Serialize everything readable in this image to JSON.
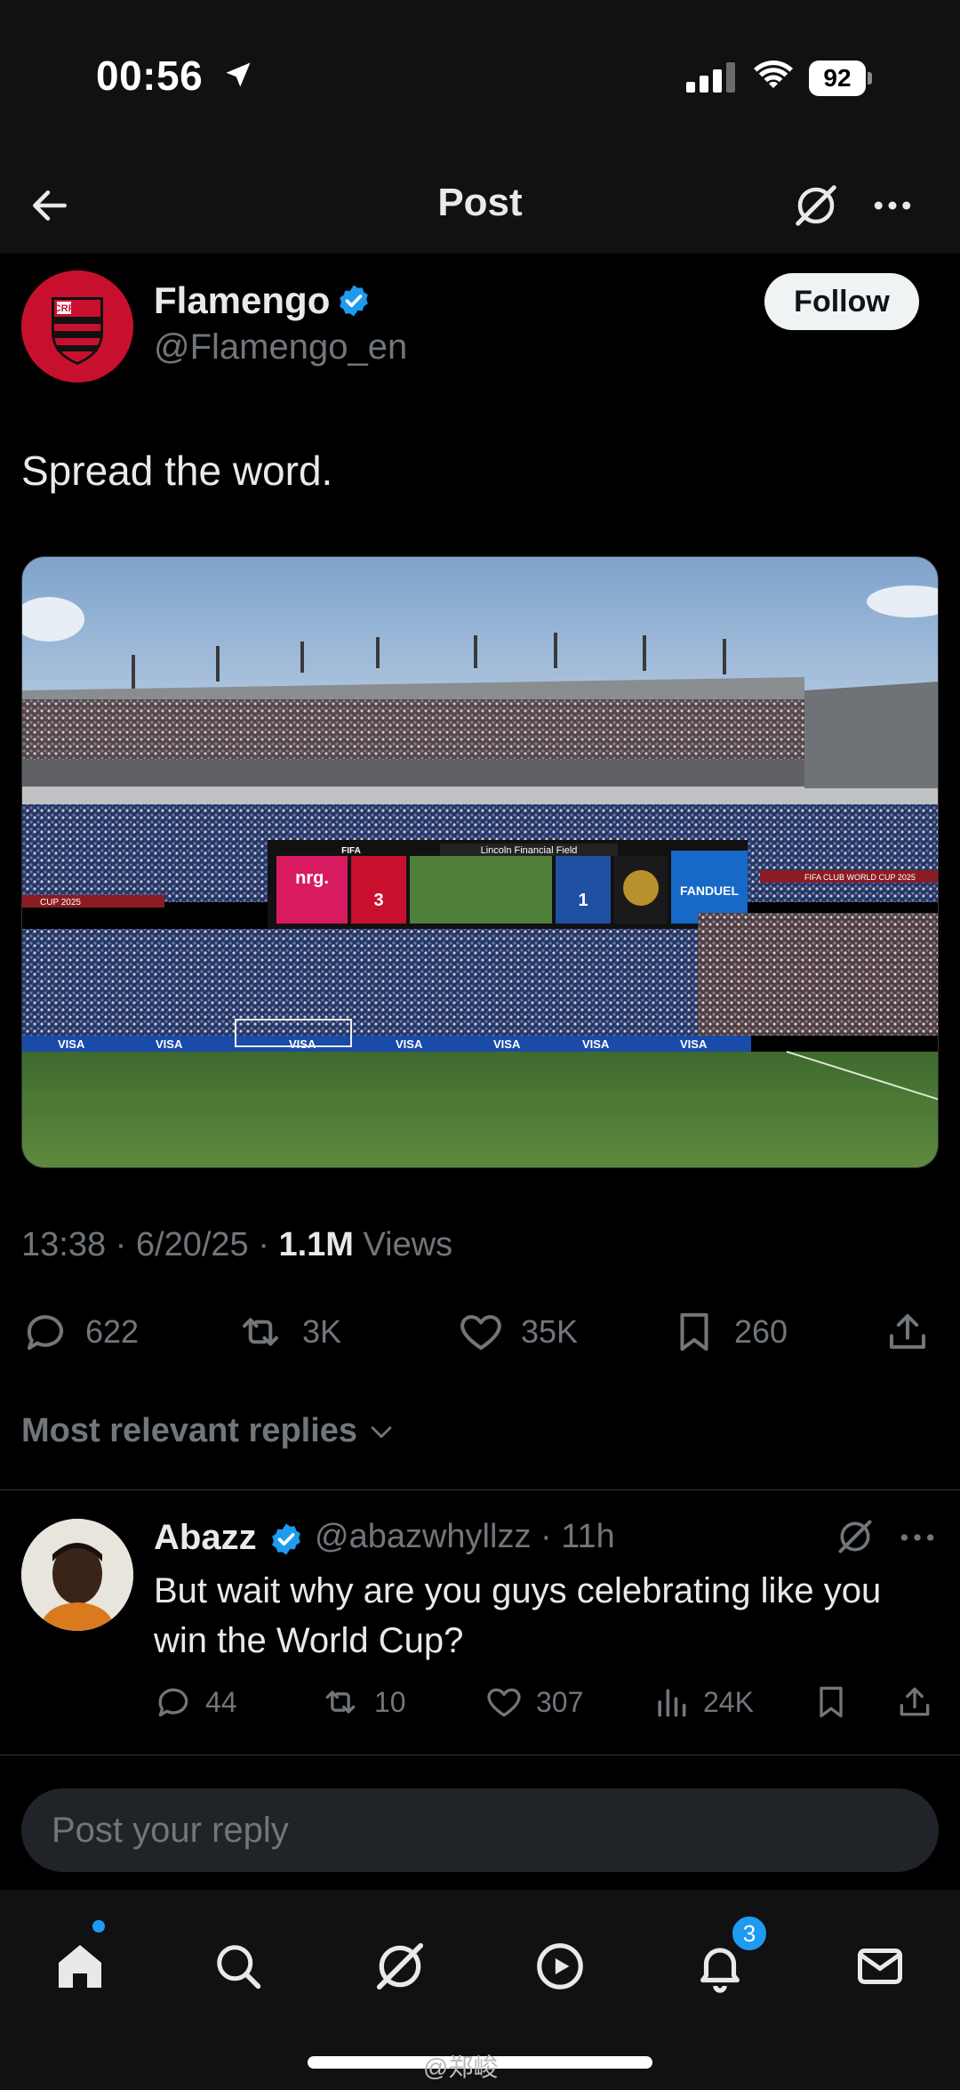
{
  "status_bar": {
    "time": "00:56",
    "battery": "92"
  },
  "header": {
    "title": "Post"
  },
  "post": {
    "author": {
      "name": "Flamengo",
      "handle": "@Flamengo_en",
      "follow_label": "Follow"
    },
    "text": "Spread the word.",
    "media": {
      "scoreboard_venue": "Lincoln Financial Field",
      "sponsor_left": "nrg.",
      "sponsor_right": "FANDUEL",
      "score_left": "3",
      "score_right": "1",
      "board_fifa": "FIFA",
      "ribbon_left": "CUP 2025",
      "ribbon_right": "FIFA CLUB WORLD CUP 2025",
      "ad_boards": [
        "VISA",
        "VISA",
        "VISA",
        "VISA",
        "VISA",
        "VISA",
        "VISA"
      ]
    },
    "meta": {
      "time": "13:38",
      "date": "6/20/25",
      "views_count": "1.1M",
      "views_label": "Views"
    },
    "stats": {
      "replies": "622",
      "reposts": "3K",
      "likes": "35K",
      "bookmarks": "260"
    }
  },
  "replies_sort": {
    "label": "Most relevant replies"
  },
  "reply": {
    "name": "Abazz",
    "handle": "@abazwhyllzz",
    "time": "11h",
    "text": "But wait why are you guys celebrating like you win the World Cup?",
    "stats": {
      "replies": "44",
      "reposts": "10",
      "likes": "307",
      "views": "24K"
    }
  },
  "reply_input": {
    "placeholder": "Post your reply"
  },
  "tabbar": {
    "notifications_badge": "3"
  },
  "watermark": "@郑峻",
  "colors": {
    "accent": "#1d9bf0",
    "flamengo_red": "#c8102e",
    "background": "#000000"
  }
}
